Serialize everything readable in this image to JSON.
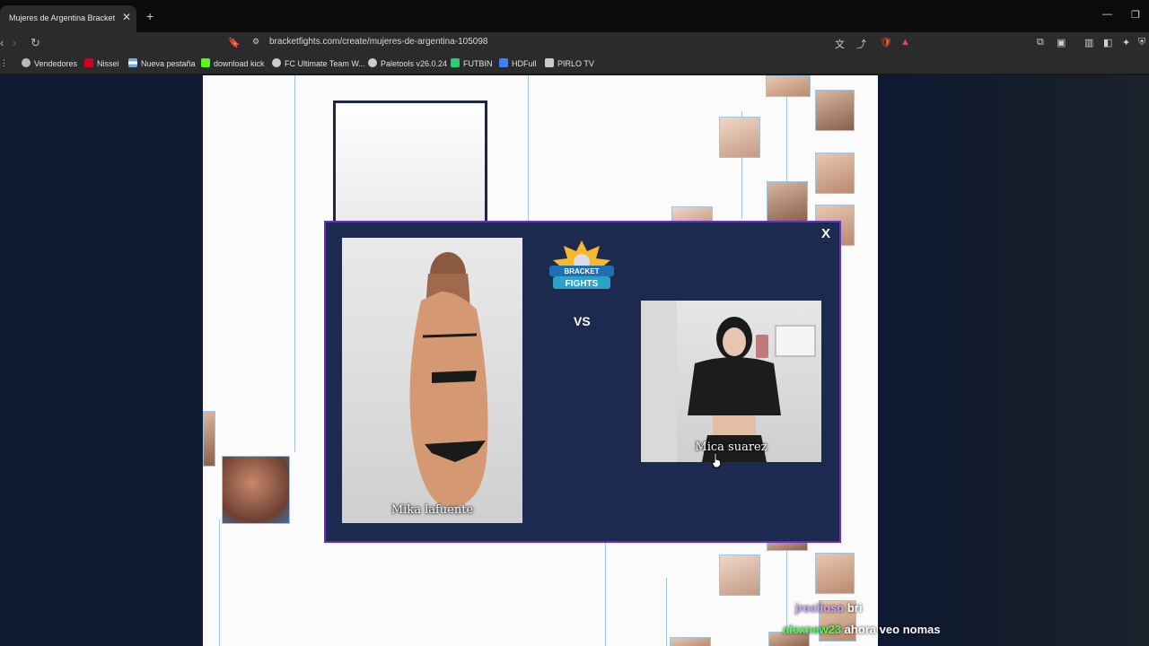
{
  "browser": {
    "tab_title": "Mujeres de Argentina Bracket - B",
    "url": "bracketfights.com/create/mujeres-de-argentina-105098"
  },
  "bookmarks": [
    {
      "label": "Vendedores",
      "color": "#bbbbbb"
    },
    {
      "label": "Nissei",
      "color": "#d0021b"
    },
    {
      "label": "Nueva pestaña",
      "color": "#74acdf"
    },
    {
      "label": "download kick",
      "color": "#53fc18"
    },
    {
      "label": "FC Ultimate Team W...",
      "color": "#cccccc"
    },
    {
      "label": "Paletools v26.0.24",
      "color": "#cccccc"
    },
    {
      "label": "FUTBIN",
      "color": "#2ecc71"
    },
    {
      "label": "HDFull",
      "color": "#3b82f6"
    },
    {
      "label": "PIRLO TV",
      "color": "#cccccc"
    }
  ],
  "matchup": {
    "vs_label": "VS",
    "close_label": "X",
    "left_name": "Mika lafuente",
    "right_name": "Mica suarez",
    "logo_top": "BRACKET",
    "logo_bottom": "FIGHTS"
  },
  "chat": [
    {
      "user": "jroclioso",
      "message": "bri",
      "color": "#c9a7ff"
    },
    {
      "user": "alexnew23",
      "message": "ahora veo nomas",
      "color": "#4cff4c"
    }
  ]
}
